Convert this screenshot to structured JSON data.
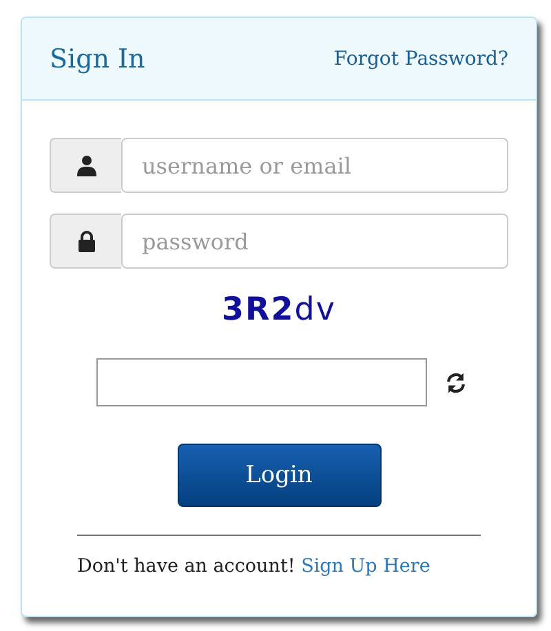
{
  "header": {
    "title": "Sign In",
    "forgot_link": "Forgot Password?"
  },
  "fields": [
    {
      "kind": "user",
      "placeholder": "username or email"
    },
    {
      "kind": "lock",
      "placeholder": "password"
    }
  ],
  "captcha": {
    "text": "**3R2**dv"
  },
  "login_button": "Login",
  "footer": {
    "text": "Don't have an account!",
    "link": "Sign Up Here"
  }
}
